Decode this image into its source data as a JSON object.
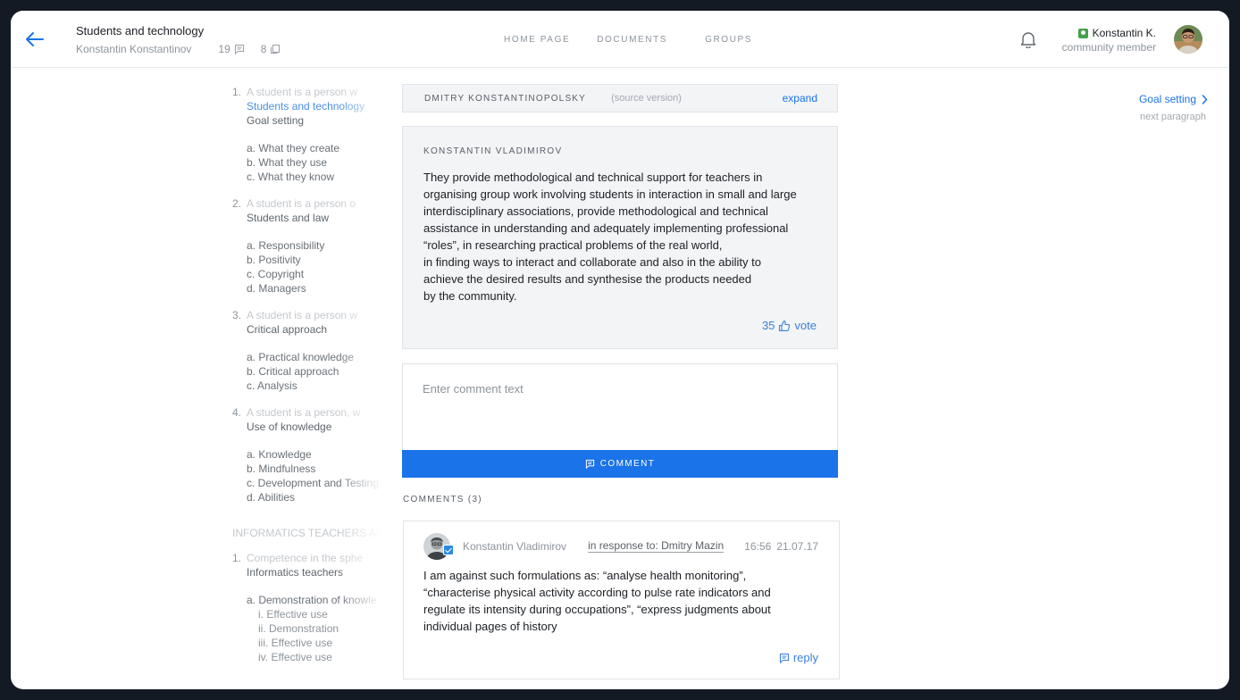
{
  "header": {
    "title": "Students and technology",
    "author": "Konstantin Konstantinov",
    "comment_count": "19",
    "doc_count": "8",
    "nav": [
      "HOME PAGE",
      "DOCUMENTS",
      "GROUPS"
    ],
    "user_name": "Konstantin K.",
    "user_role": "community member"
  },
  "toc": {
    "sections": [
      {
        "num": "1.",
        "lead": "A student is a person w",
        "topics": [
          {
            "text": "Students and technology",
            "active": true
          },
          {
            "text": "Goal setting",
            "active": false
          }
        ],
        "items": [
          "a. What they create",
          "b. What they use",
          "c. What they know"
        ]
      },
      {
        "num": "2.",
        "lead": "A student is a person o",
        "topics": [
          {
            "text": "Students and law",
            "active": false
          }
        ],
        "items": [
          "a. Responsibility",
          "b. Positivity",
          "c. Copyright",
          "d. Managers"
        ]
      },
      {
        "num": "3.",
        "lead": "A student is a person w",
        "topics": [
          {
            "text": "Critical approach",
            "active": false
          }
        ],
        "items": [
          "a. Practical knowledge",
          "b. Critical approach",
          "c. Analysis"
        ]
      },
      {
        "num": "4.",
        "lead": "A student is a person, w",
        "topics": [
          {
            "text": "Use of knowledge",
            "active": false
          }
        ],
        "items": [
          "a. Knowledge",
          "b. Mindfulness",
          "c. Development and Testing",
          "d. Abilities"
        ]
      }
    ],
    "section_heading": "INFORMATICS TEACHERS AN",
    "section5": {
      "num": "1.",
      "lead": "Competence in the sphe",
      "topic": "Informatics teachers",
      "item": "a. Demonstration of knowle",
      "subitems": [
        "i.   Effective use",
        "ii.  Demonstration",
        "iii. Effective use",
        "iv. Effective use"
      ]
    }
  },
  "source": {
    "author": "DMITRY KONSTANTINOPOLSKY",
    "version": "(source version)",
    "expand": "expand"
  },
  "card": {
    "author": "KONSTANTIN VLADIMIROV",
    "text": "They provide methodological and technical support for teachers in\norganising group work involving students in interaction in small and large\ninterdisciplinary associations, provide methodological and technical\nassistance in understanding and adequately implementing professional\n“roles”, in researching practical problems of the real world,\nin finding ways to interact and collaborate and also in the ability to\nachieve the desired results and synthesise the products needed\nby the community.",
    "vote_count": "35",
    "vote_label": "vote"
  },
  "comment_form": {
    "placeholder": "Enter comment text",
    "button": "COMMENT"
  },
  "comments": {
    "heading": "COMMENTS (3)",
    "items": [
      {
        "name": "Konstantin Vladimirov",
        "response": "in response to: Dmitry Mazin",
        "time": "16:56",
        "date": "21.07.17",
        "text": "I am against such formulations as: “analyse health monitoring”,\n “characterise physical activity according to pulse rate indicators and\nregulate its intensity during occupations”, “express judgments about\nindividual pages of history",
        "reply": "reply"
      }
    ]
  },
  "next": {
    "label": "Goal setting",
    "sub": "next paragraph"
  },
  "colors": {
    "accent": "#1a73e8",
    "badge": "#43a047"
  }
}
